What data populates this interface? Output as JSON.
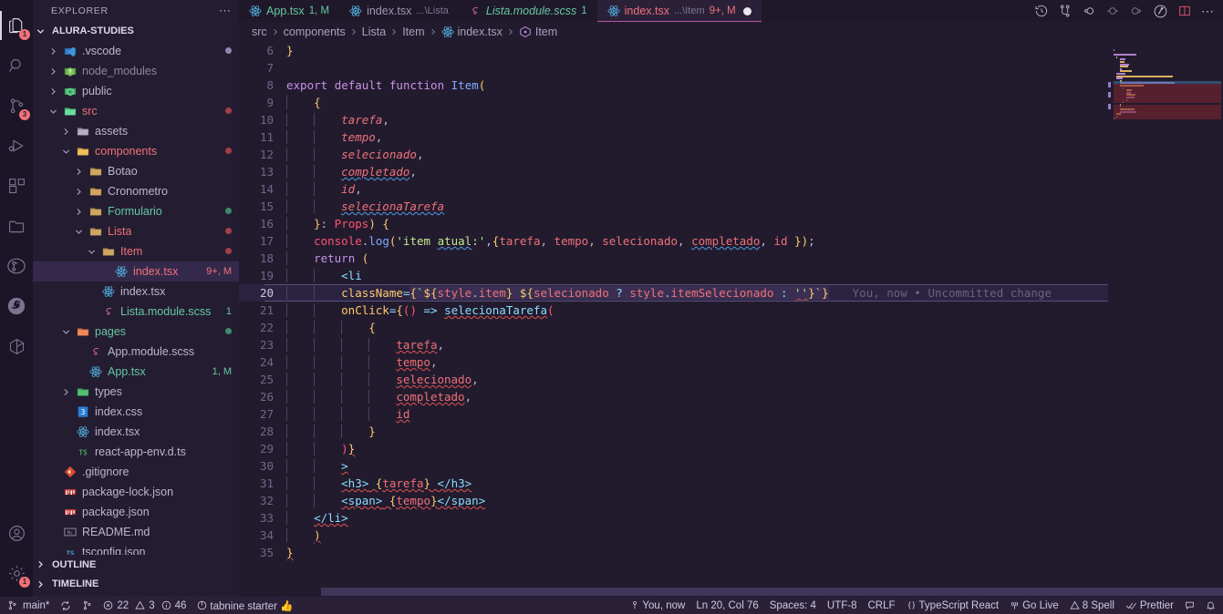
{
  "activitybar": {
    "items": [
      {
        "name": "explorer",
        "icon": "files-icon",
        "badge": "1",
        "active": true
      },
      {
        "name": "search",
        "icon": "search-icon",
        "badge": "",
        "active": false
      },
      {
        "name": "source-control",
        "icon": "source-control-icon",
        "badge": "3",
        "active": false
      },
      {
        "name": "run-and-debug",
        "icon": "run-debug-icon",
        "badge": "",
        "active": false
      },
      {
        "name": "extensions",
        "icon": "extensions-icon",
        "badge": "",
        "active": false
      },
      {
        "name": "remote-explorer",
        "icon": "folder-icon",
        "badge": "",
        "active": false
      },
      {
        "name": "git-graph",
        "icon": "git-graph-icon",
        "badge": "",
        "active": false
      },
      {
        "name": "live-share",
        "icon": "live-share-icon",
        "badge": "",
        "active": false
      },
      {
        "name": "docker",
        "icon": "docker-icon",
        "badge": "",
        "active": false
      }
    ],
    "bottom": [
      {
        "name": "accounts",
        "icon": "account-icon",
        "badge": ""
      },
      {
        "name": "manage",
        "icon": "gear-icon",
        "badge": "1"
      }
    ]
  },
  "sidebar": {
    "title": "EXPLORER",
    "more_label": "⋯",
    "root": "ALURA-STUDIES",
    "footer": [
      {
        "label": "OUTLINE"
      },
      {
        "label": "TIMELINE"
      }
    ],
    "items": [
      {
        "label": ".vscode",
        "indent": 1,
        "twisty": "collapsed",
        "icon": "vscode-folder-icon",
        "color": "#bdb5cf",
        "deco": "",
        "decoColor": "",
        "dot": "#8f86b5",
        "selected": false
      },
      {
        "label": "node_modules",
        "indent": 1,
        "twisty": "collapsed",
        "icon": "node-folder-icon",
        "color": "#8d86a3",
        "deco": "",
        "decoColor": "",
        "dot": "",
        "selected": false
      },
      {
        "label": "public",
        "indent": 1,
        "twisty": "collapsed",
        "icon": "public-folder-icon",
        "color": "#bdb5cf",
        "deco": "",
        "decoColor": "",
        "dot": "",
        "selected": false
      },
      {
        "label": "src",
        "indent": 1,
        "twisty": "expanded",
        "icon": "src-folder-icon",
        "color": "#f07178",
        "deco": "",
        "decoColor": "",
        "dot": "#a33f4a",
        "selected": false
      },
      {
        "label": "assets",
        "indent": 2,
        "twisty": "collapsed",
        "icon": "assets-folder-icon",
        "color": "#bdb5cf",
        "deco": "",
        "decoColor": "",
        "dot": "",
        "selected": false
      },
      {
        "label": "components",
        "indent": 2,
        "twisty": "expanded",
        "icon": "components-folder-icon",
        "color": "#f07178",
        "deco": "",
        "decoColor": "",
        "dot": "#a33f4a",
        "selected": false
      },
      {
        "label": "Botao",
        "indent": 3,
        "twisty": "collapsed",
        "icon": "folder-icon",
        "color": "#bdb5cf",
        "deco": "",
        "decoColor": "",
        "dot": "",
        "selected": false
      },
      {
        "label": "Cronometro",
        "indent": 3,
        "twisty": "collapsed",
        "icon": "folder-icon",
        "color": "#bdb5cf",
        "deco": "",
        "decoColor": "",
        "dot": "",
        "selected": false
      },
      {
        "label": "Formulario",
        "indent": 3,
        "twisty": "collapsed",
        "icon": "folder-icon",
        "color": "#66c7a0",
        "deco": "",
        "decoColor": "",
        "dot": "#3f8a6a",
        "selected": false
      },
      {
        "label": "Lista",
        "indent": 3,
        "twisty": "expanded",
        "icon": "folder-icon",
        "color": "#f07178",
        "deco": "",
        "decoColor": "",
        "dot": "#a33f4a",
        "selected": false
      },
      {
        "label": "Item",
        "indent": 4,
        "twisty": "expanded",
        "icon": "folder-icon",
        "color": "#f07178",
        "deco": "",
        "decoColor": "",
        "dot": "#a33f4a",
        "selected": false
      },
      {
        "label": "index.tsx",
        "indent": 5,
        "twisty": "none",
        "icon": "react-icon",
        "color": "#f07178",
        "deco": "9+, M",
        "decoColor": "#f07178",
        "dot": "",
        "selected": true
      },
      {
        "label": "index.tsx",
        "indent": 4,
        "twisty": "none",
        "icon": "react-icon",
        "color": "#bdb5cf",
        "deco": "",
        "decoColor": "",
        "dot": "",
        "selected": false
      },
      {
        "label": "Lista.module.scss",
        "indent": 4,
        "twisty": "none",
        "icon": "sass-icon",
        "color": "#66c7a0",
        "deco": "1",
        "decoColor": "#66c7a0",
        "dot": "",
        "selected": false
      },
      {
        "label": "pages",
        "indent": 2,
        "twisty": "expanded",
        "icon": "pages-folder-icon",
        "color": "#66c7a0",
        "deco": "",
        "decoColor": "",
        "dot": "#3f8a6a",
        "selected": false
      },
      {
        "label": "App.module.scss",
        "indent": 3,
        "twisty": "none",
        "icon": "sass-icon",
        "color": "#bdb5cf",
        "deco": "",
        "decoColor": "",
        "dot": "",
        "selected": false
      },
      {
        "label": "App.tsx",
        "indent": 3,
        "twisty": "none",
        "icon": "react-icon",
        "color": "#66c7a0",
        "deco": "1, M",
        "decoColor": "#66c7a0",
        "dot": "",
        "selected": false
      },
      {
        "label": "types",
        "indent": 2,
        "twisty": "collapsed",
        "icon": "ts-folder-icon",
        "color": "#bdb5cf",
        "deco": "",
        "decoColor": "",
        "dot": "",
        "selected": false
      },
      {
        "label": "index.css",
        "indent": 2,
        "twisty": "none",
        "icon": "css-icon",
        "color": "#bdb5cf",
        "deco": "",
        "decoColor": "",
        "dot": "",
        "selected": false
      },
      {
        "label": "index.tsx",
        "indent": 2,
        "twisty": "none",
        "icon": "react-icon",
        "color": "#bdb5cf",
        "deco": "",
        "decoColor": "",
        "dot": "",
        "selected": false
      },
      {
        "label": "react-app-env.d.ts",
        "indent": 2,
        "twisty": "none",
        "icon": "ts-icon",
        "color": "#bdb5cf",
        "deco": "",
        "decoColor": "",
        "dot": "",
        "selected": false
      },
      {
        "label": ".gitignore",
        "indent": 1,
        "twisty": "none",
        "icon": "git-icon",
        "color": "#bdb5cf",
        "deco": "",
        "decoColor": "",
        "dot": "",
        "selected": false
      },
      {
        "label": "package-lock.json",
        "indent": 1,
        "twisty": "none",
        "icon": "npm-icon",
        "color": "#bdb5cf",
        "deco": "",
        "decoColor": "",
        "dot": "",
        "selected": false
      },
      {
        "label": "package.json",
        "indent": 1,
        "twisty": "none",
        "icon": "npm-icon",
        "color": "#bdb5cf",
        "deco": "",
        "decoColor": "",
        "dot": "",
        "selected": false
      },
      {
        "label": "README.md",
        "indent": 1,
        "twisty": "none",
        "icon": "markdown-icon",
        "color": "#bdb5cf",
        "deco": "",
        "decoColor": "",
        "dot": "",
        "selected": false
      },
      {
        "label": "tsconfig.json",
        "indent": 1,
        "twisty": "none",
        "icon": "tsconfig-icon",
        "color": "#bdb5cf",
        "deco": "",
        "decoColor": "",
        "dot": "",
        "selected": false
      }
    ]
  },
  "tabs": [
    {
      "name": "App.tsx",
      "sub": "",
      "deco": "1, M",
      "icon": "react-icon",
      "active": false,
      "dirty": false,
      "labelColor": "#66c7a0",
      "decoColor": "#66c7a0"
    },
    {
      "name": "index.tsx",
      "sub": "...\\Lista",
      "deco": "",
      "icon": "react-icon",
      "active": false,
      "dirty": false,
      "labelColor": "#9d96b3",
      "decoColor": ""
    },
    {
      "name": "Lista.module.scss",
      "sub": "",
      "deco": "1",
      "icon": "sass-icon",
      "active": false,
      "dirty": false,
      "labelColor": "#66c7a0",
      "decoColor": "#66c7a0",
      "italic": true
    },
    {
      "name": "index.tsx",
      "sub": "...\\Item",
      "deco": "9+, M",
      "icon": "react-icon",
      "active": true,
      "dirty": true,
      "labelColor": "#f07178",
      "decoColor": "#f07178"
    }
  ],
  "editor_actions": [
    {
      "name": "timeline-icon",
      "glyph": "history"
    },
    {
      "name": "split-graph-icon",
      "glyph": "graph"
    },
    {
      "name": "step-back-icon",
      "glyph": "stepback"
    },
    {
      "name": "record-icon",
      "glyph": "record"
    },
    {
      "name": "step-forward-icon",
      "glyph": "stepfwd"
    },
    {
      "name": "run-icon",
      "glyph": "run"
    },
    {
      "name": "split-editor-icon",
      "glyph": "split"
    },
    {
      "name": "more-actions-icon",
      "glyph": "dots"
    }
  ],
  "breadcrumbs": [
    {
      "label": "src",
      "icon": ""
    },
    {
      "label": "components",
      "icon": ""
    },
    {
      "label": "Lista",
      "icon": ""
    },
    {
      "label": "Item",
      "icon": ""
    },
    {
      "label": "index.tsx",
      "icon": "react-icon"
    },
    {
      "label": "Item",
      "icon": "symbol-class-icon"
    }
  ],
  "editor": {
    "first_line": 6,
    "current_line": 20,
    "blame": "You, now • Uncommitted change",
    "lines": [
      {
        "n": 6,
        "text": "}"
      },
      {
        "n": 7,
        "text": ""
      },
      {
        "n": 8,
        "text": "export default function Item("
      },
      {
        "n": 9,
        "text": "    {"
      },
      {
        "n": 10,
        "text": "        tarefa,"
      },
      {
        "n": 11,
        "text": "        tempo,"
      },
      {
        "n": 12,
        "text": "        selecionado,"
      },
      {
        "n": 13,
        "text": "        completado,"
      },
      {
        "n": 14,
        "text": "        id,"
      },
      {
        "n": 15,
        "text": "        selecionaTarefa"
      },
      {
        "n": 16,
        "text": "    }: Props) {"
      },
      {
        "n": 17,
        "text": "    console.log('item atual:',{tarefa, tempo, selecionado, completado, id });"
      },
      {
        "n": 18,
        "text": "    return ("
      },
      {
        "n": 19,
        "text": "        <li"
      },
      {
        "n": 20,
        "text": "        className={`${style.item} ${selecionado ? style.itemSelecionado : ''}`}"
      },
      {
        "n": 21,
        "text": "        onClick={() => selecionaTarefa("
      },
      {
        "n": 22,
        "text": "            {"
      },
      {
        "n": 23,
        "text": "                tarefa,"
      },
      {
        "n": 24,
        "text": "                tempo,"
      },
      {
        "n": 25,
        "text": "                selecionado,"
      },
      {
        "n": 26,
        "text": "                completado,"
      },
      {
        "n": 27,
        "text": "                id"
      },
      {
        "n": 28,
        "text": "            }"
      },
      {
        "n": 29,
        "text": "        )}"
      },
      {
        "n": 30,
        "text": "        >"
      },
      {
        "n": 31,
        "text": "        <h3> {tarefa} </h3>"
      },
      {
        "n": 32,
        "text": "        <span> {tempo}</span>"
      },
      {
        "n": 33,
        "text": "    </li>"
      },
      {
        "n": 34,
        "text": "    )"
      },
      {
        "n": 35,
        "text": "}"
      }
    ]
  },
  "statusbar": {
    "left": [
      {
        "name": "remote-indicator",
        "icon": "remote-icon",
        "label": ""
      },
      {
        "name": "branch",
        "icon": "branch-icon",
        "label": "main*"
      },
      {
        "name": "sync",
        "icon": "sync-icon",
        "label": ""
      },
      {
        "name": "publish",
        "icon": "publish-icon",
        "label": ""
      },
      {
        "name": "errors",
        "icon": "error-icon",
        "label": "22"
      },
      {
        "name": "warnings",
        "icon": "warning-icon",
        "label": "3"
      },
      {
        "name": "infos",
        "icon": "info-icon",
        "label": "46"
      },
      {
        "name": "tabnine",
        "icon": "tabnine-icon",
        "label": "tabnine starter 👍"
      }
    ],
    "right": [
      {
        "name": "git-blame",
        "icon": "blame-icon",
        "label": "You, now"
      },
      {
        "name": "cursor-position",
        "icon": "",
        "label": "Ln 20, Col 76"
      },
      {
        "name": "indentation",
        "icon": "",
        "label": "Spaces: 4"
      },
      {
        "name": "encoding",
        "icon": "",
        "label": "UTF-8"
      },
      {
        "name": "eol",
        "icon": "",
        "label": "CRLF"
      },
      {
        "name": "language-mode",
        "icon": "braces-icon",
        "label": "TypeScript React"
      },
      {
        "name": "go-live",
        "icon": "broadcast-icon",
        "label": "Go Live"
      },
      {
        "name": "spell-checker",
        "icon": "warning-icon",
        "label": "8 Spell"
      },
      {
        "name": "prettier",
        "icon": "check-icon",
        "label": "Prettier"
      },
      {
        "name": "feedback",
        "icon": "feedback-icon",
        "label": ""
      },
      {
        "name": "notifications",
        "icon": "bell-icon",
        "label": ""
      }
    ]
  },
  "theme": {
    "bg": "#221b2e",
    "sidebar_bg": "#241d31",
    "activitybar_bg": "#1b1527",
    "statusbar_bg": "#2a2139",
    "accent": "#f07178",
    "tab_active_border": "#b857a8"
  }
}
